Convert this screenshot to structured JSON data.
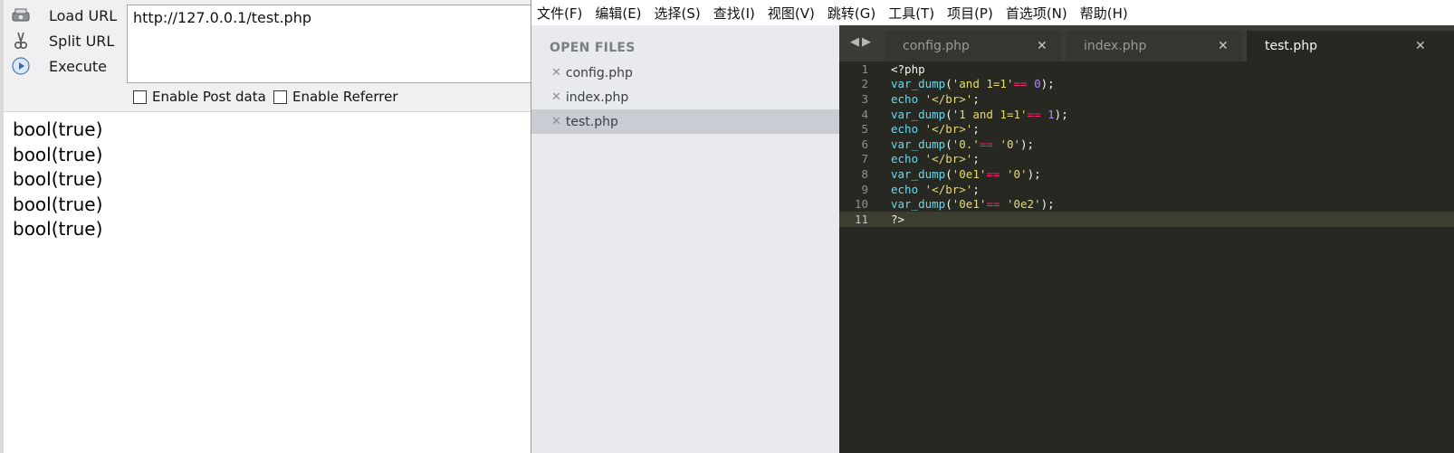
{
  "hackbar": {
    "load_label": "Load URL",
    "split_label": "Split URL",
    "execute_label": "Execute",
    "url_value": "http://127.0.0.1/test.php",
    "post_label": "Enable Post data",
    "referrer_label": "Enable Referrer"
  },
  "output": {
    "lines": [
      "bool(true)",
      "bool(true)",
      "bool(true)",
      "bool(true)",
      "bool(true)"
    ]
  },
  "menu": {
    "items": [
      "文件(F)",
      "编辑(E)",
      "选择(S)",
      "查找(I)",
      "视图(V)",
      "跳转(G)",
      "工具(T)",
      "项目(P)",
      "首选项(N)",
      "帮助(H)"
    ]
  },
  "sidebar": {
    "title": "OPEN FILES",
    "files": [
      {
        "name": "config.php",
        "active": false
      },
      {
        "name": "index.php",
        "active": false
      },
      {
        "name": "test.php",
        "active": true
      }
    ]
  },
  "tabs": [
    {
      "name": "config.php",
      "active": false
    },
    {
      "name": "index.php",
      "active": false
    },
    {
      "name": "test.php",
      "active": true
    }
  ],
  "editor": {
    "current_line": 11,
    "lines": [
      [
        {
          "t": "plain",
          "v": "<?php"
        }
      ],
      [
        {
          "t": "fn",
          "v": "var_dump"
        },
        {
          "t": "plain",
          "v": "("
        },
        {
          "t": "str",
          "v": "'and 1=1'"
        },
        {
          "t": "op",
          "v": "=="
        },
        {
          "t": "plain",
          "v": " "
        },
        {
          "t": "num",
          "v": "0"
        },
        {
          "t": "plain",
          "v": ");"
        }
      ],
      [
        {
          "t": "fn",
          "v": "echo"
        },
        {
          "t": "plain",
          "v": " "
        },
        {
          "t": "str",
          "v": "'</br>'"
        },
        {
          "t": "plain",
          "v": ";"
        }
      ],
      [
        {
          "t": "fn",
          "v": "var_dump"
        },
        {
          "t": "plain",
          "v": "("
        },
        {
          "t": "str",
          "v": "'1 and 1=1'"
        },
        {
          "t": "op",
          "v": "=="
        },
        {
          "t": "plain",
          "v": " "
        },
        {
          "t": "num",
          "v": "1"
        },
        {
          "t": "plain",
          "v": ");"
        }
      ],
      [
        {
          "t": "fn",
          "v": "echo"
        },
        {
          "t": "plain",
          "v": " "
        },
        {
          "t": "str",
          "v": "'</br>'"
        },
        {
          "t": "plain",
          "v": ";"
        }
      ],
      [
        {
          "t": "fn",
          "v": "var_dump"
        },
        {
          "t": "plain",
          "v": "("
        },
        {
          "t": "str",
          "v": "'0.'"
        },
        {
          "t": "op",
          "v": "=="
        },
        {
          "t": "plain",
          "v": " "
        },
        {
          "t": "str",
          "v": "'0'"
        },
        {
          "t": "plain",
          "v": ");"
        }
      ],
      [
        {
          "t": "fn",
          "v": "echo"
        },
        {
          "t": "plain",
          "v": " "
        },
        {
          "t": "str",
          "v": "'</br>'"
        },
        {
          "t": "plain",
          "v": ";"
        }
      ],
      [
        {
          "t": "fn",
          "v": "var_dump"
        },
        {
          "t": "plain",
          "v": "("
        },
        {
          "t": "str",
          "v": "'0e1'"
        },
        {
          "t": "op",
          "v": "=="
        },
        {
          "t": "plain",
          "v": " "
        },
        {
          "t": "str",
          "v": "'0'"
        },
        {
          "t": "plain",
          "v": ");"
        }
      ],
      [
        {
          "t": "fn",
          "v": "echo"
        },
        {
          "t": "plain",
          "v": " "
        },
        {
          "t": "str",
          "v": "'</br>'"
        },
        {
          "t": "plain",
          "v": ";"
        }
      ],
      [
        {
          "t": "fn",
          "v": "var_dump"
        },
        {
          "t": "plain",
          "v": "("
        },
        {
          "t": "str",
          "v": "'0e1'"
        },
        {
          "t": "op",
          "v": "=="
        },
        {
          "t": "plain",
          "v": " "
        },
        {
          "t": "str",
          "v": "'0e2'"
        },
        {
          "t": "plain",
          "v": ");"
        }
      ],
      [
        {
          "t": "plain",
          "v": "?>"
        }
      ]
    ]
  },
  "colors": {
    "editor_bg": "#272822",
    "keyword": "#66d9ef",
    "string": "#e6db74",
    "operator": "#f92672",
    "number": "#ae81ff"
  },
  "icons": {
    "load": "load-url-icon",
    "split": "split-url-icon",
    "execute": "execute-icon",
    "close": "close-icon"
  }
}
